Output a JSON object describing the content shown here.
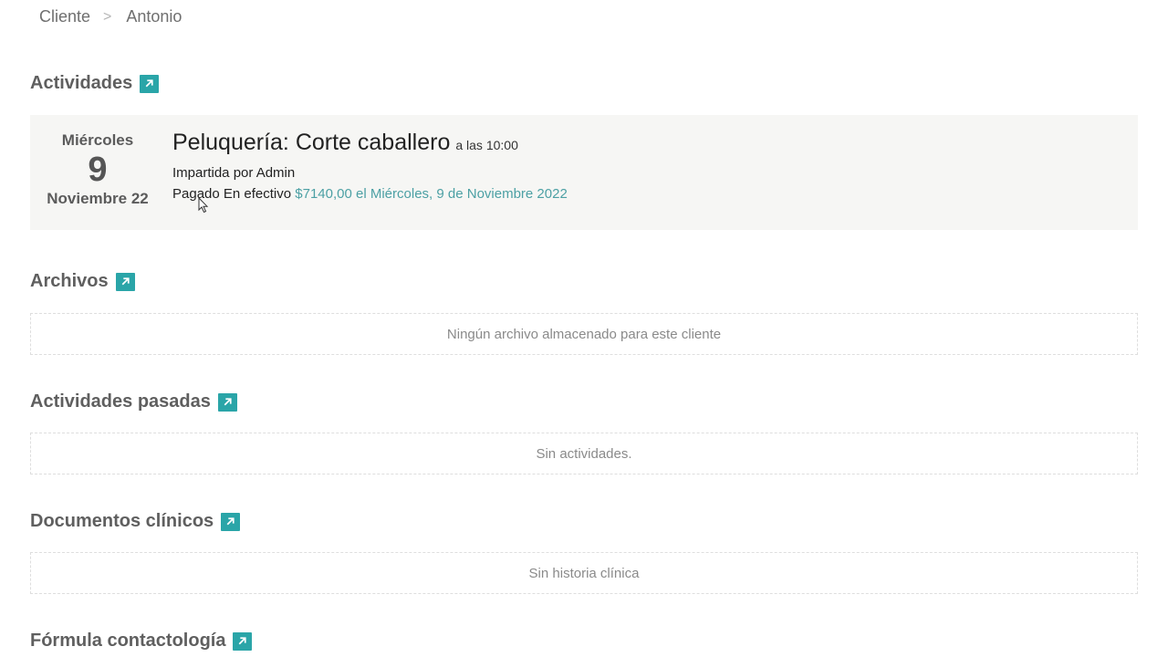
{
  "breadcrumb": {
    "items": [
      "Cliente",
      "Antonio"
    ],
    "separator": ">"
  },
  "sections": {
    "activities": {
      "title": "Actividades",
      "card": {
        "weekday": "Miércoles",
        "day": "9",
        "month_year": "Noviembre 22",
        "service": "Peluquería: Corte caballero",
        "time": "a las 10:00",
        "teacher": "Impartida por Admin",
        "payment_status": "Pagado",
        "payment_method": "En efectivo",
        "payment_detail": "$7140,00 el Miércoles, 9 de Noviembre 2022"
      }
    },
    "files": {
      "title": "Archivos",
      "empty_text": "Ningún archivo almacenado para este cliente"
    },
    "past_activities": {
      "title": "Actividades pasadas",
      "empty_text": "Sin actividades."
    },
    "clinical_docs": {
      "title": "Documentos clínicos",
      "empty_text": "Sin historia clínica"
    },
    "contact_lens": {
      "title": "Fórmula contactología"
    }
  },
  "icons": {
    "external_link": "external-link-icon",
    "breadcrumb_separator": "chevron-right-icon"
  },
  "colors": {
    "accent": "#2aa5a8",
    "link": "#4ca0a4",
    "card_background": "#f6f6f4"
  }
}
